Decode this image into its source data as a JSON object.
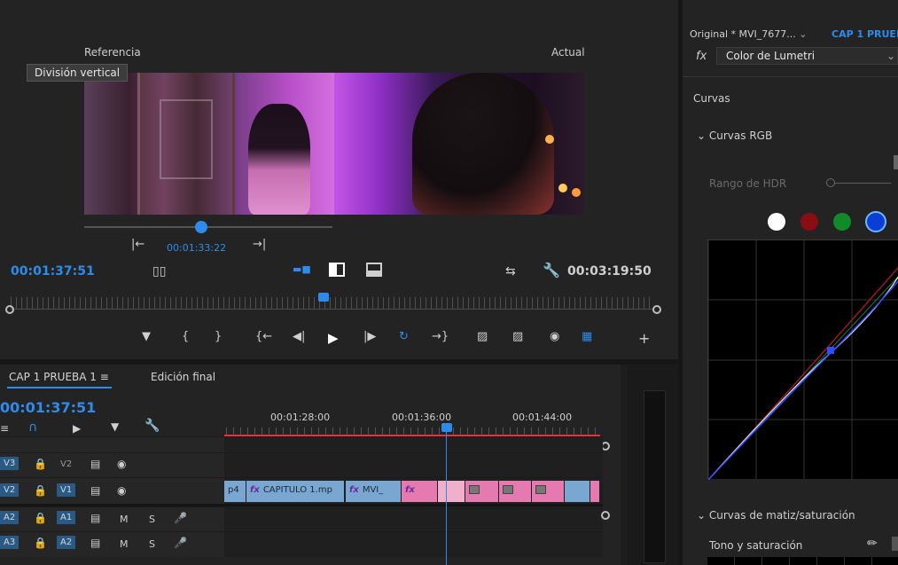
{
  "monitor": {
    "reference_label": "Referencia",
    "current_label": "Actual",
    "tooltip": "División vertical",
    "comparison_timecode": "00:01:33:22",
    "playhead_timecode": "00:01:37:51",
    "duration_timecode": "00:03:19:50"
  },
  "timeline": {
    "tabs": [
      {
        "label": "CAP 1 PRUEBA 1 ≡"
      },
      {
        "label": "Edición final"
      }
    ],
    "timecode": "00:01:37:51",
    "ruler_marks": [
      "00:01:28:00",
      "00:01:36:00",
      "00:01:44:00"
    ],
    "tracks": [
      {
        "name": "V3",
        "src": "V3"
      },
      {
        "name": "V2",
        "src": "V3"
      },
      {
        "name": "V1",
        "src": "V2"
      },
      {
        "name": "A1",
        "src": "A2"
      },
      {
        "name": "A2",
        "src": "A3"
      }
    ],
    "clips": {
      "c1": "p4",
      "c2": "CAPITULO 1.mp",
      "c3": "MVI_"
    },
    "audio_m": "M",
    "audio_s": "S"
  },
  "lumetri": {
    "source": "Original * MVI_7677...",
    "sequence": "CAP 1 PRUEB",
    "effect": "Color de Lumetri",
    "section_curves": "Curvas",
    "section_rgb": "Curvas RGB",
    "hdr_range": "Rango de HDR",
    "section_hue_sat": "Curvas de matiz/saturación",
    "hue_sat": "Tono y saturación"
  },
  "colors": {
    "accent": "#2d8ceb",
    "in_out_bar": "#e8313a",
    "clip_video": "#7aa7d1",
    "clip_fx": "#e57ab0"
  }
}
